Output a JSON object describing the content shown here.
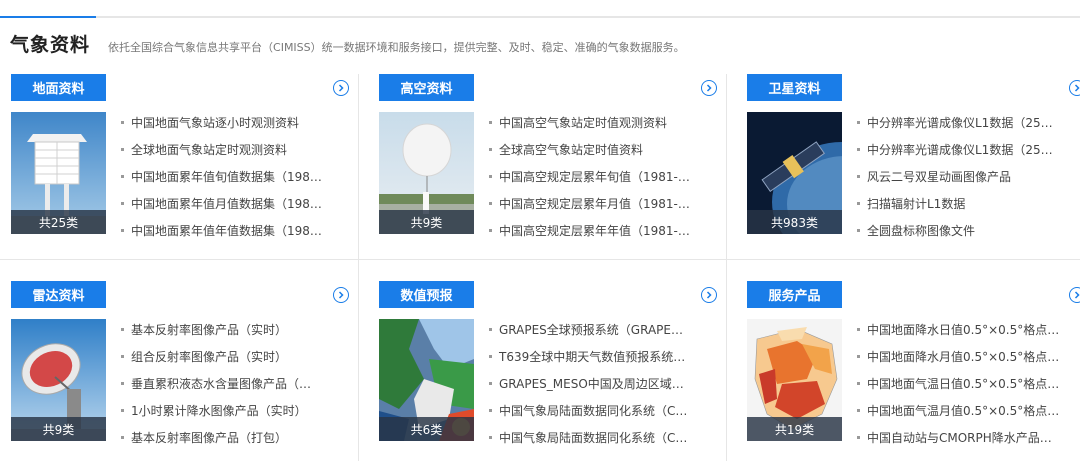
{
  "header": {
    "title": "气象资料",
    "description": "依托全国综合气象信息共享平台（CIMISS）统一数据环境和服务接口，提供完整、及时、稳定、准确的气象数据服务。"
  },
  "colors": {
    "accent": "#1a7de8",
    "count_bg": "#283446",
    "divider": "#e6e6e6"
  },
  "panels": [
    {
      "label": "地面资料",
      "count": "共25类",
      "more_icon": "chevron-right-circle-icon",
      "thumbnail": "weather-station-photo",
      "items": [
        "中国地面气象站逐小时观测资料",
        "全球地面气象站定时观测资料",
        "中国地面累年值旬值数据集（198…",
        "中国地面累年值月值数据集（198…",
        "中国地面累年值年值数据集（198…"
      ]
    },
    {
      "label": "高空资料",
      "count": "共9类",
      "more_icon": "chevron-right-circle-icon",
      "thumbnail": "sounding-balloon-photo",
      "items": [
        "中国高空气象站定时值观测资料",
        "全球高空气象站定时值资料",
        "中国高空规定层累年旬值（1981-…",
        "中国高空规定层累年月值（1981-…",
        "中国高空规定层累年年值（1981-…"
      ]
    },
    {
      "label": "卫星资料",
      "count": "共983类",
      "more_icon": "chevron-right-circle-icon",
      "thumbnail": "satellite-photo",
      "items": [
        "中分辨率光谱成像仪L1数据（25…",
        "中分辨率光谱成像仪L1数据（25…",
        "风云二号双星动画图像产品",
        "扫描辐射计L1数据",
        "全圆盘标称图像文件"
      ]
    },
    {
      "label": "雷达资料",
      "count": "共9类",
      "more_icon": "chevron-right-circle-icon",
      "thumbnail": "radar-dish-photo",
      "items": [
        "基本反射率图像产品（实时）",
        "组合反射率图像产品（实时）",
        "垂直累积液态水含量图像产品（…",
        "1小时累计降水图像产品（实时）",
        "基本反射率图像产品（打包）"
      ]
    },
    {
      "label": "数值预报",
      "count": "共6类",
      "more_icon": "chevron-right-circle-icon",
      "thumbnail": "forecast-map-image",
      "items": [
        "GRAPES全球预报系统（GRAPE…",
        "T639全球中期天气数值预报系统…",
        "GRAPES_MESO中国及周边区域…",
        "中国气象局陆面数据同化系统（C…",
        "中国气象局陆面数据同化系统（C…"
      ]
    },
    {
      "label": "服务产品",
      "count": "共19类",
      "more_icon": "chevron-right-circle-icon",
      "thumbnail": "china-precip-map-image",
      "items": [
        "中国地面降水日值0.5°×0.5°格点…",
        "中国地面降水月值0.5°×0.5°格点…",
        "中国地面气温日值0.5°×0.5°格点…",
        "中国地面气温月值0.5°×0.5°格点…",
        "中国自动站与CMORPH降水产品…"
      ]
    }
  ]
}
